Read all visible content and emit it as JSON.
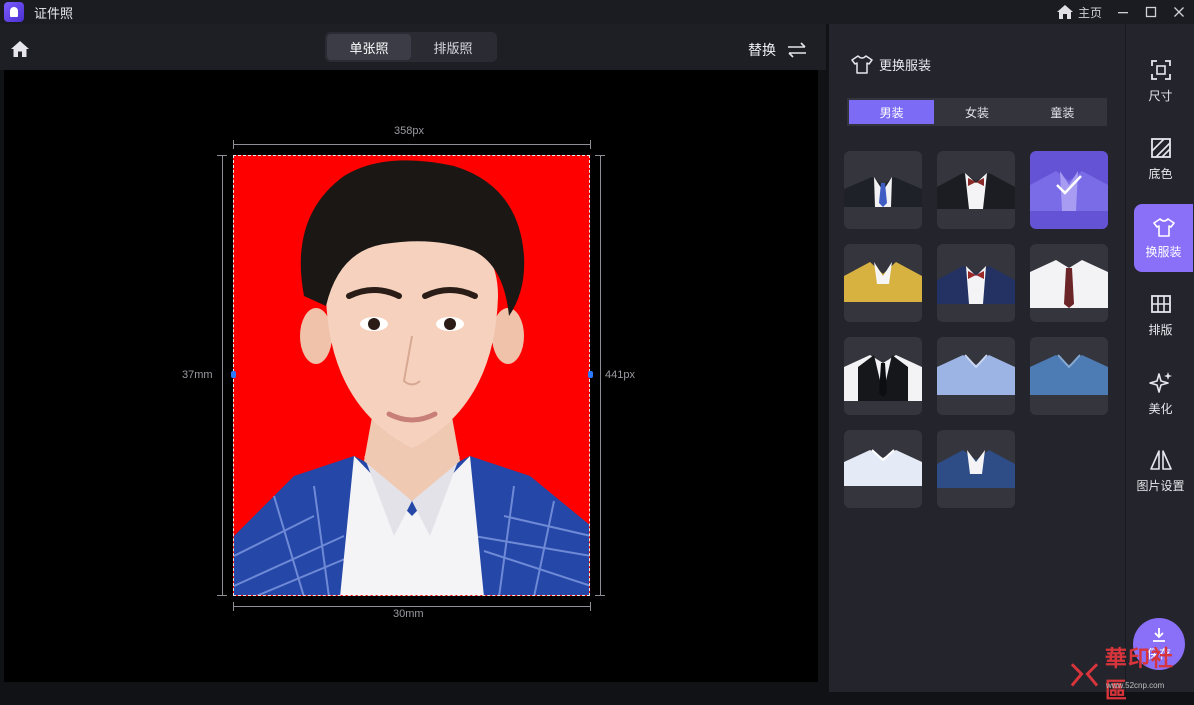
{
  "window": {
    "title": "证件照",
    "home_label": "主页"
  },
  "toolbar": {
    "tabs": [
      {
        "label": "单张照",
        "active": true
      },
      {
        "label": "排版照",
        "active": false
      }
    ],
    "replace_label": "替换"
  },
  "photo": {
    "background_color": "#ff0000",
    "width_px_label": "358px",
    "height_px_label": "441px",
    "width_mm_label": "30mm",
    "height_mm_label": "37mm"
  },
  "clothes_panel": {
    "title": "更换服装",
    "categories": [
      {
        "label": "男装",
        "active": true
      },
      {
        "label": "女装",
        "active": false
      },
      {
        "label": "童装",
        "active": false
      }
    ],
    "items": [
      {
        "name": "black-suit-blue-tie"
      },
      {
        "name": "black-suit-bowtie"
      },
      {
        "name": "blue-suit-selected",
        "selected": true
      },
      {
        "name": "yellow-jacket"
      },
      {
        "name": "navy-suit-bowtie"
      },
      {
        "name": "white-shirt-tie"
      },
      {
        "name": "black-vest-tie"
      },
      {
        "name": "light-blue-shirt"
      },
      {
        "name": "denim-shirt"
      },
      {
        "name": "white-shirt"
      },
      {
        "name": "blue-blazer"
      }
    ]
  },
  "sidenav": {
    "items": [
      {
        "label": "尺寸",
        "icon": "crop-icon"
      },
      {
        "label": "底色",
        "icon": "background-color-icon"
      },
      {
        "label": "换服装",
        "icon": "shirt-icon",
        "active": true
      },
      {
        "label": "排版",
        "icon": "layout-grid-icon"
      },
      {
        "label": "美化",
        "icon": "sparkle-icon"
      },
      {
        "label": "图片设置",
        "icon": "image-settings-icon"
      }
    ],
    "save_label": "保存"
  },
  "watermark": {
    "text": "華印社區",
    "url": "www.52cnp.com"
  }
}
